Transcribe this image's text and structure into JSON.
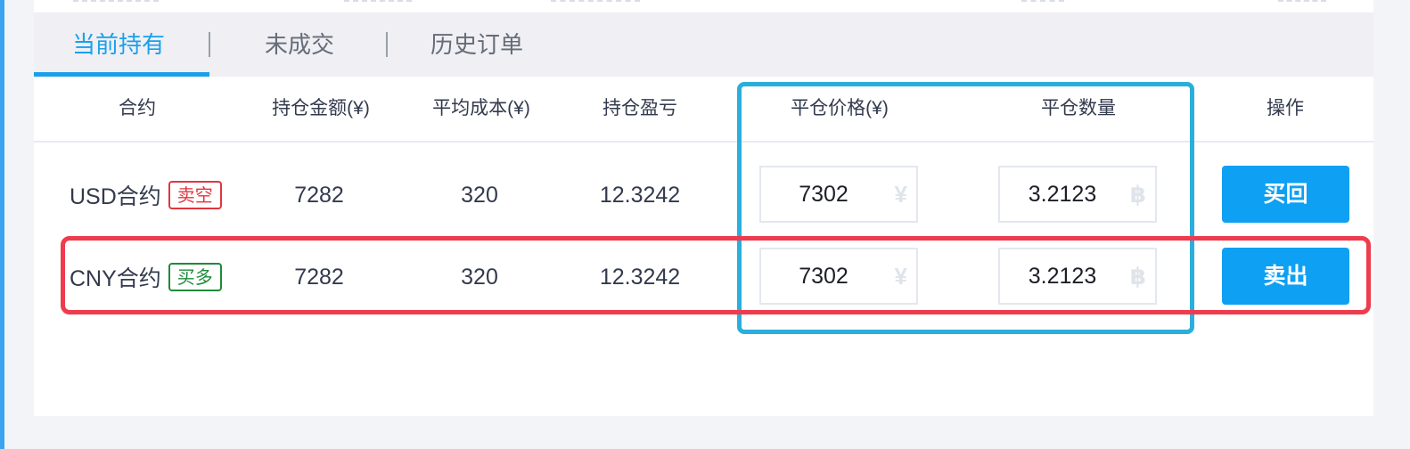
{
  "tabs": [
    {
      "label": "当前持有",
      "active": true
    },
    {
      "label": "未成交",
      "active": false
    },
    {
      "label": "历史订单",
      "active": false
    }
  ],
  "columns": [
    "合约",
    "持仓金额(¥)",
    "平均成本(¥)",
    "持仓盈亏",
    "平仓价格(¥)",
    "平仓数量",
    "操作"
  ],
  "rows": [
    {
      "contract": "USD合约",
      "side": "卖空",
      "amount": "7282",
      "avg_cost": "320",
      "pnl": "12.3242",
      "close_price": "7302",
      "price_unit": "¥",
      "close_qty": "3.2123",
      "qty_unit": "฿",
      "action": "买回"
    },
    {
      "contract": "CNY合约",
      "side": "买多",
      "amount": "7282",
      "avg_cost": "320",
      "pnl": "12.3242",
      "close_price": "7302",
      "price_unit": "¥",
      "close_qty": "3.2123",
      "qty_unit": "฿",
      "action": "卖出"
    }
  ],
  "colors": {
    "accent": "#1aa0ea",
    "button": "#0ea0f2",
    "short_badge": "#e0363f",
    "long_badge": "#1f8a3a",
    "highlight_blue": "#2aaedc",
    "highlight_red": "#ee3b4d"
  }
}
